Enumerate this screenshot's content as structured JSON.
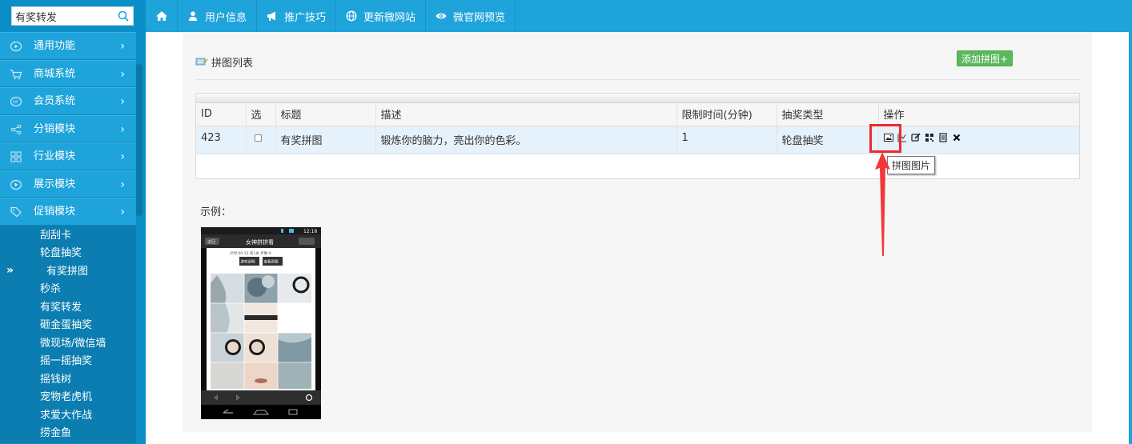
{
  "sidebar": {
    "search": {
      "value": "有奖转发",
      "icon": "search-icon"
    },
    "menu": [
      {
        "label": "通用功能",
        "icon": "play-circle-icon"
      },
      {
        "label": "商城系统",
        "icon": "cart-icon"
      },
      {
        "label": "会员系统",
        "icon": "vip-icon"
      },
      {
        "label": "分销模块",
        "icon": "share-icon"
      },
      {
        "label": "行业模块",
        "icon": "grid-icon"
      },
      {
        "label": "展示模块",
        "icon": "play-circle-icon"
      },
      {
        "label": "促销模块",
        "icon": "tag-icon"
      }
    ],
    "submenu": [
      "刮刮卡",
      "轮盘抽奖",
      "有奖拼图",
      "秒杀",
      "有奖转发",
      "砸金蛋抽奖",
      "微现场/微信墙",
      "摇一摇抽奖",
      "摇钱树",
      "宠物老虎机",
      "求爱大作战",
      "捞金鱼"
    ],
    "active_sub": "有奖拼图",
    "collapse": "»"
  },
  "topnav": {
    "items": [
      {
        "label": "用户信息",
        "icon": "user-icon"
      },
      {
        "label": "推广技巧",
        "icon": "megaphone-icon"
      },
      {
        "label": "更新微网站",
        "icon": "globe-icon"
      },
      {
        "label": "微官网预览",
        "icon": "eye-icon"
      }
    ]
  },
  "main": {
    "title": "拼图列表",
    "add_button": "添加拼图+",
    "table": {
      "headers": [
        "ID",
        "选",
        "标题",
        "描述",
        "限制时间(分钟)",
        "抽奖类型",
        "操作"
      ],
      "rows": [
        {
          "id": "423",
          "title": "有奖拼图",
          "desc": "锻炼你的脑力，亮出你的色彩。",
          "limit": "1",
          "type": "轮盘抽奖"
        }
      ]
    },
    "tooltip": "拼图图片",
    "example_label": "示例："
  },
  "phone": {
    "time": "12:16",
    "back": "返回",
    "title": "女神拼拼看",
    "stats": "计时:00:13 第1关 步数:0",
    "btn1": "游戏说明",
    "btn2": "查看原图"
  }
}
